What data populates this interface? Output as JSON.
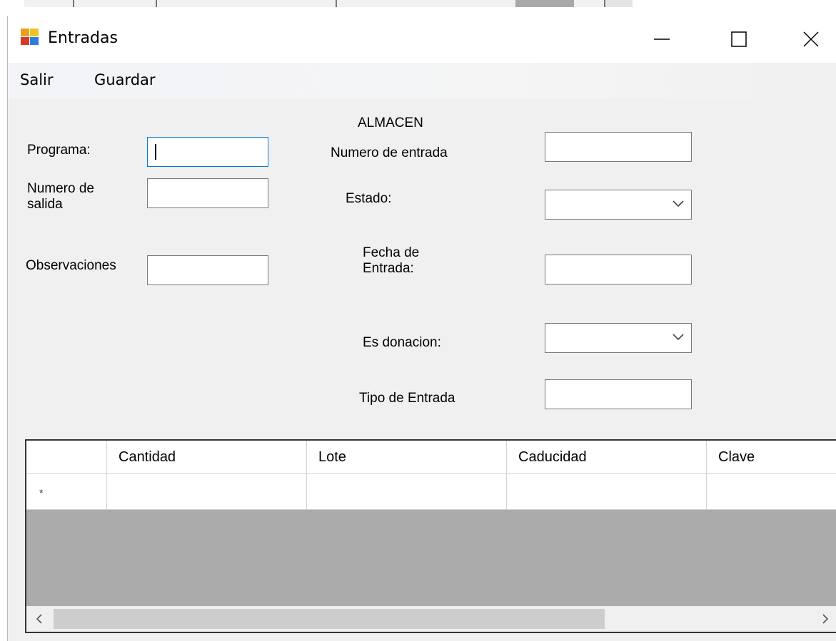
{
  "window": {
    "title": "Entradas",
    "icon": "form-app-icon",
    "controls": [
      "minimize-icon",
      "maximize-icon",
      "close-icon"
    ]
  },
  "menu": {
    "salir": "Salir",
    "guardar": "Guardar"
  },
  "form": {
    "almacen_label": "ALMACEN",
    "programa_label": "Programa:",
    "programa_value": "",
    "numero_salida_label_1": "Numero de",
    "numero_salida_label_2": "salida",
    "numero_salida_value": "",
    "observaciones_label": "Observaciones",
    "observaciones_value": "",
    "numero_entrada_label": "Numero de entrada",
    "numero_entrada_value": "",
    "estado_label": "Estado:",
    "estado_value": "",
    "fecha_entrada_label_1": "Fecha de",
    "fecha_entrada_label_2": "Entrada:",
    "fecha_entrada_value": "",
    "es_donacion_label": "Es donacion:",
    "es_donacion_value": "",
    "tipo_entrada_label": "Tipo de Entrada",
    "tipo_entrada_value": ""
  },
  "grid": {
    "columns": [
      "Cantidad",
      "Lote",
      "Caducidad",
      "Clave"
    ],
    "new_row_marker": "*",
    "rows": []
  },
  "colors": {
    "focus_border": "#0078d7",
    "grid_background": "#ababab",
    "form_background": "#f0f0f0"
  }
}
